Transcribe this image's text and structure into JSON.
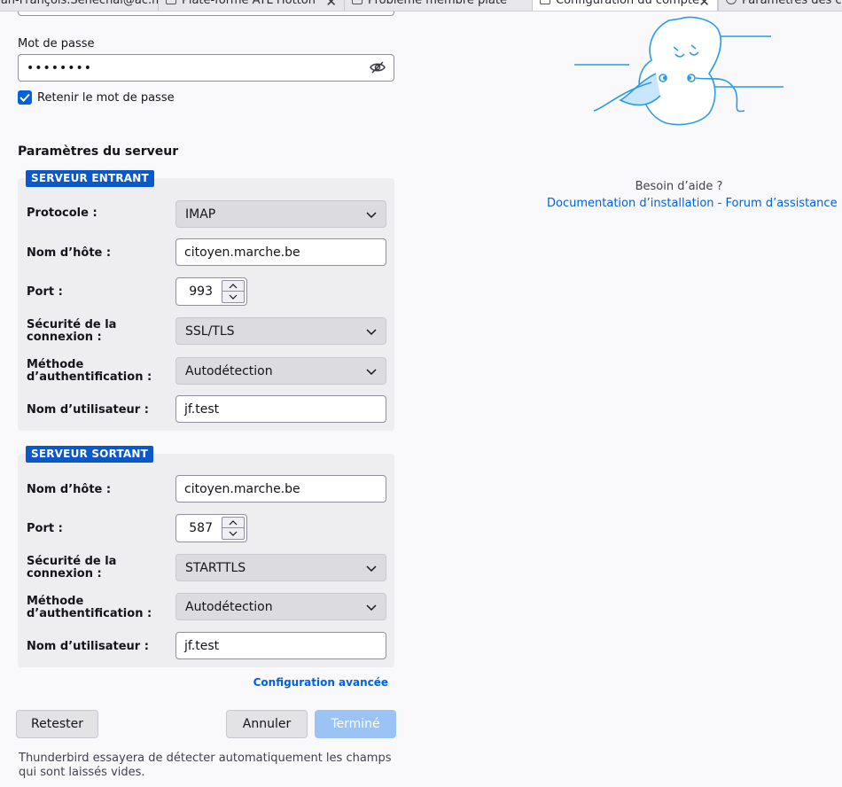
{
  "tabs": [
    {
      "label": "Jean-François.Senechal@ac.m",
      "icon": "user-icon",
      "active": false
    },
    {
      "label": "Plate-forme ATL Hotton",
      "icon": "document-icon",
      "active": false
    },
    {
      "label": "Problème membre plate",
      "icon": "document-icon",
      "active": false
    },
    {
      "label": "Configuration du compte",
      "icon": "mail-settings-icon",
      "active": true
    },
    {
      "label": "Paramètres des co",
      "icon": "gear-icon",
      "active": false
    }
  ],
  "password": {
    "label": "Mot de passe",
    "value": "••••••••"
  },
  "remember": {
    "label": "Retenir le mot de passe",
    "checked": true
  },
  "server_settings_title": "Paramètres du serveur",
  "incoming": {
    "badge": "SERVEUR ENTRANT",
    "protocol_label": "Protocole :",
    "protocol": "IMAP",
    "hostname_label": "Nom d’hôte :",
    "hostname": "citoyen.marche.be",
    "port_label": "Port :",
    "port": "993",
    "security_label_1": "Sécurité de la",
    "security_label_2": "connexion :",
    "security": "SSL/TLS",
    "auth_label_1": "Méthode",
    "auth_label_2": "d’authentification :",
    "auth": "Autodétection",
    "username_label": "Nom d’utilisateur :",
    "username": "jf.test"
  },
  "outgoing": {
    "badge": "SERVEUR SORTANT",
    "hostname_label": "Nom d’hôte :",
    "hostname": "citoyen.marche.be",
    "port_label": "Port :",
    "port": "587",
    "security_label_1": "Sécurité de la",
    "security_label_2": "connexion :",
    "security": "STARTTLS",
    "auth_label_1": "Méthode",
    "auth_label_2": "d’authentification :",
    "auth": "Autodétection",
    "username_label": "Nom d’utilisateur :",
    "username": "jf.test"
  },
  "advanced_link": "Configuration avancée",
  "buttons": {
    "retest": "Retester",
    "cancel": "Annuler",
    "done": "Terminé"
  },
  "hint": "Thunderbird essayera de détecter automatiquement les champs qui sont laissés vides.",
  "help": {
    "question": "Besoin d’aide ?",
    "docs_link": "Documentation d’installation",
    "separator": " - ",
    "forum_link": "Forum d’assistance"
  },
  "colors": {
    "accent": "#0061e0",
    "badge": "#0a58ca",
    "done_disabled": "#9cc3f5"
  }
}
